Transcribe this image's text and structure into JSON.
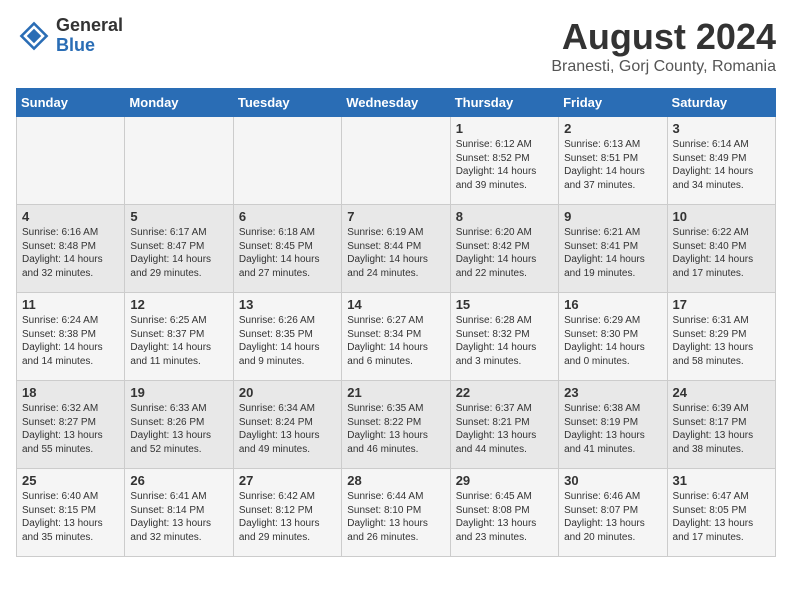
{
  "header": {
    "logo_general": "General",
    "logo_blue": "Blue",
    "month_title": "August 2024",
    "subtitle": "Branesti, Gorj County, Romania"
  },
  "days_of_week": [
    "Sunday",
    "Monday",
    "Tuesday",
    "Wednesday",
    "Thursday",
    "Friday",
    "Saturday"
  ],
  "weeks": [
    [
      {
        "day": "",
        "info": ""
      },
      {
        "day": "",
        "info": ""
      },
      {
        "day": "",
        "info": ""
      },
      {
        "day": "",
        "info": ""
      },
      {
        "day": "1",
        "info": "Sunrise: 6:12 AM\nSunset: 8:52 PM\nDaylight: 14 hours and 39 minutes."
      },
      {
        "day": "2",
        "info": "Sunrise: 6:13 AM\nSunset: 8:51 PM\nDaylight: 14 hours and 37 minutes."
      },
      {
        "day": "3",
        "info": "Sunrise: 6:14 AM\nSunset: 8:49 PM\nDaylight: 14 hours and 34 minutes."
      }
    ],
    [
      {
        "day": "4",
        "info": "Sunrise: 6:16 AM\nSunset: 8:48 PM\nDaylight: 14 hours and 32 minutes."
      },
      {
        "day": "5",
        "info": "Sunrise: 6:17 AM\nSunset: 8:47 PM\nDaylight: 14 hours and 29 minutes."
      },
      {
        "day": "6",
        "info": "Sunrise: 6:18 AM\nSunset: 8:45 PM\nDaylight: 14 hours and 27 minutes."
      },
      {
        "day": "7",
        "info": "Sunrise: 6:19 AM\nSunset: 8:44 PM\nDaylight: 14 hours and 24 minutes."
      },
      {
        "day": "8",
        "info": "Sunrise: 6:20 AM\nSunset: 8:42 PM\nDaylight: 14 hours and 22 minutes."
      },
      {
        "day": "9",
        "info": "Sunrise: 6:21 AM\nSunset: 8:41 PM\nDaylight: 14 hours and 19 minutes."
      },
      {
        "day": "10",
        "info": "Sunrise: 6:22 AM\nSunset: 8:40 PM\nDaylight: 14 hours and 17 minutes."
      }
    ],
    [
      {
        "day": "11",
        "info": "Sunrise: 6:24 AM\nSunset: 8:38 PM\nDaylight: 14 hours and 14 minutes."
      },
      {
        "day": "12",
        "info": "Sunrise: 6:25 AM\nSunset: 8:37 PM\nDaylight: 14 hours and 11 minutes."
      },
      {
        "day": "13",
        "info": "Sunrise: 6:26 AM\nSunset: 8:35 PM\nDaylight: 14 hours and 9 minutes."
      },
      {
        "day": "14",
        "info": "Sunrise: 6:27 AM\nSunset: 8:34 PM\nDaylight: 14 hours and 6 minutes."
      },
      {
        "day": "15",
        "info": "Sunrise: 6:28 AM\nSunset: 8:32 PM\nDaylight: 14 hours and 3 minutes."
      },
      {
        "day": "16",
        "info": "Sunrise: 6:29 AM\nSunset: 8:30 PM\nDaylight: 14 hours and 0 minutes."
      },
      {
        "day": "17",
        "info": "Sunrise: 6:31 AM\nSunset: 8:29 PM\nDaylight: 13 hours and 58 minutes."
      }
    ],
    [
      {
        "day": "18",
        "info": "Sunrise: 6:32 AM\nSunset: 8:27 PM\nDaylight: 13 hours and 55 minutes."
      },
      {
        "day": "19",
        "info": "Sunrise: 6:33 AM\nSunset: 8:26 PM\nDaylight: 13 hours and 52 minutes."
      },
      {
        "day": "20",
        "info": "Sunrise: 6:34 AM\nSunset: 8:24 PM\nDaylight: 13 hours and 49 minutes."
      },
      {
        "day": "21",
        "info": "Sunrise: 6:35 AM\nSunset: 8:22 PM\nDaylight: 13 hours and 46 minutes."
      },
      {
        "day": "22",
        "info": "Sunrise: 6:37 AM\nSunset: 8:21 PM\nDaylight: 13 hours and 44 minutes."
      },
      {
        "day": "23",
        "info": "Sunrise: 6:38 AM\nSunset: 8:19 PM\nDaylight: 13 hours and 41 minutes."
      },
      {
        "day": "24",
        "info": "Sunrise: 6:39 AM\nSunset: 8:17 PM\nDaylight: 13 hours and 38 minutes."
      }
    ],
    [
      {
        "day": "25",
        "info": "Sunrise: 6:40 AM\nSunset: 8:15 PM\nDaylight: 13 hours and 35 minutes."
      },
      {
        "day": "26",
        "info": "Sunrise: 6:41 AM\nSunset: 8:14 PM\nDaylight: 13 hours and 32 minutes."
      },
      {
        "day": "27",
        "info": "Sunrise: 6:42 AM\nSunset: 8:12 PM\nDaylight: 13 hours and 29 minutes."
      },
      {
        "day": "28",
        "info": "Sunrise: 6:44 AM\nSunset: 8:10 PM\nDaylight: 13 hours and 26 minutes."
      },
      {
        "day": "29",
        "info": "Sunrise: 6:45 AM\nSunset: 8:08 PM\nDaylight: 13 hours and 23 minutes."
      },
      {
        "day": "30",
        "info": "Sunrise: 6:46 AM\nSunset: 8:07 PM\nDaylight: 13 hours and 20 minutes."
      },
      {
        "day": "31",
        "info": "Sunrise: 6:47 AM\nSunset: 8:05 PM\nDaylight: 13 hours and 17 minutes."
      }
    ]
  ]
}
